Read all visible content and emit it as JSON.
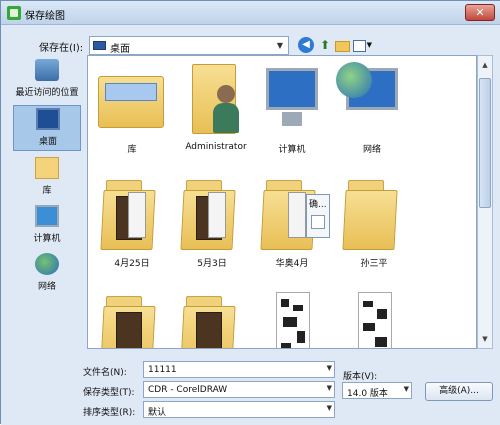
{
  "window": {
    "title": "保存绘图",
    "close_label": "✕"
  },
  "toolbar": {
    "lookin_label": "保存在(I):",
    "lookin_value": "桌面",
    "views_caret": "▼"
  },
  "places": [
    {
      "label": "最近访问的位置"
    },
    {
      "label": "桌面"
    },
    {
      "label": "库"
    },
    {
      "label": "计算机"
    },
    {
      "label": "网络"
    }
  ],
  "items": [
    {
      "label": "库"
    },
    {
      "label": "Administrator"
    },
    {
      "label": "计算机"
    },
    {
      "label": "网络"
    },
    {
      "label": "4月25日"
    },
    {
      "label": "5月3日"
    },
    {
      "label": "华奥4月"
    },
    {
      "label": "孙三平"
    },
    {
      "label": ""
    },
    {
      "label": ""
    },
    {
      "label": ""
    },
    {
      "label": ""
    }
  ],
  "popup": {
    "text": "确..."
  },
  "form": {
    "filename_label": "文件名(N):",
    "filename_value": "11111",
    "savetype_label": "保存类型(T):",
    "savetype_value": "CDR - CorelDRAW",
    "sorttype_label": "排序类型(R):",
    "sorttype_value": "默认",
    "version_label": "版本(V):",
    "version_value": "14.0 版本",
    "advanced_label": "高级(A)..."
  }
}
